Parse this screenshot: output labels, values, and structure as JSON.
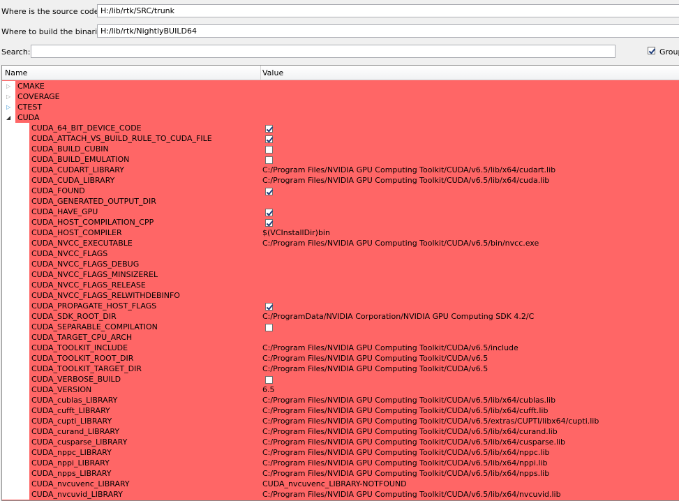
{
  "source": {
    "label": "Where is the source code:",
    "value": "H:/lib/rtk/SRC/trunk"
  },
  "build": {
    "label": "Where to build the binaries:",
    "value": "H:/lib/rtk/NightlyBUILD64"
  },
  "search": {
    "label": "Search:",
    "value": ""
  },
  "grouped": {
    "label": "Group",
    "checked": true
  },
  "columns": {
    "name": "Name",
    "value": "Value"
  },
  "colors": {
    "highlight": "#ff6666",
    "window": "#f0f0f0"
  },
  "groups": [
    {
      "name": "CMAKE",
      "expanded": false,
      "arrow": "gray"
    },
    {
      "name": "COVERAGE",
      "expanded": false,
      "arrow": "gray"
    },
    {
      "name": "CTEST",
      "expanded": false,
      "arrow": "blue"
    },
    {
      "name": "CUDA",
      "expanded": true,
      "arrow": "dark"
    }
  ],
  "entries": [
    {
      "name": "CUDA_64_BIT_DEVICE_CODE",
      "type": "bool",
      "checked": true
    },
    {
      "name": "CUDA_ATTACH_VS_BUILD_RULE_TO_CUDA_FILE",
      "type": "bool",
      "checked": true
    },
    {
      "name": "CUDA_BUILD_CUBIN",
      "type": "bool",
      "checked": false
    },
    {
      "name": "CUDA_BUILD_EMULATION",
      "type": "bool",
      "checked": false
    },
    {
      "name": "CUDA_CUDART_LIBRARY",
      "type": "text",
      "value": "C:/Program Files/NVIDIA GPU Computing Toolkit/CUDA/v6.5/lib/x64/cudart.lib"
    },
    {
      "name": "CUDA_CUDA_LIBRARY",
      "type": "text",
      "value": "C:/Program Files/NVIDIA GPU Computing Toolkit/CUDA/v6.5/lib/x64/cuda.lib"
    },
    {
      "name": "CUDA_FOUND",
      "type": "bool",
      "checked": true
    },
    {
      "name": "CUDA_GENERATED_OUTPUT_DIR",
      "type": "text",
      "value": ""
    },
    {
      "name": "CUDA_HAVE_GPU",
      "type": "bool",
      "checked": true
    },
    {
      "name": "CUDA_HOST_COMPILATION_CPP",
      "type": "bool",
      "checked": true
    },
    {
      "name": "CUDA_HOST_COMPILER",
      "type": "text",
      "value": "$(VCInstallDir)bin"
    },
    {
      "name": "CUDA_NVCC_EXECUTABLE",
      "type": "text",
      "value": "C:/Program Files/NVIDIA GPU Computing Toolkit/CUDA/v6.5/bin/nvcc.exe"
    },
    {
      "name": "CUDA_NVCC_FLAGS",
      "type": "text",
      "value": ""
    },
    {
      "name": "CUDA_NVCC_FLAGS_DEBUG",
      "type": "text",
      "value": ""
    },
    {
      "name": "CUDA_NVCC_FLAGS_MINSIZEREL",
      "type": "text",
      "value": ""
    },
    {
      "name": "CUDA_NVCC_FLAGS_RELEASE",
      "type": "text",
      "value": ""
    },
    {
      "name": "CUDA_NVCC_FLAGS_RELWITHDEBINFO",
      "type": "text",
      "value": ""
    },
    {
      "name": "CUDA_PROPAGATE_HOST_FLAGS",
      "type": "bool",
      "checked": true
    },
    {
      "name": "CUDA_SDK_ROOT_DIR",
      "type": "text",
      "value": "C:/ProgramData/NVIDIA Corporation/NVIDIA GPU Computing SDK 4.2/C"
    },
    {
      "name": "CUDA_SEPARABLE_COMPILATION",
      "type": "bool",
      "checked": false
    },
    {
      "name": "CUDA_TARGET_CPU_ARCH",
      "type": "text",
      "value": ""
    },
    {
      "name": "CUDA_TOOLKIT_INCLUDE",
      "type": "text",
      "value": "C:/Program Files/NVIDIA GPU Computing Toolkit/CUDA/v6.5/include"
    },
    {
      "name": "CUDA_TOOLKIT_ROOT_DIR",
      "type": "text",
      "value": "C:/Program Files/NVIDIA GPU Computing Toolkit/CUDA/v6.5"
    },
    {
      "name": "CUDA_TOOLKIT_TARGET_DIR",
      "type": "text",
      "value": "C:/Program Files/NVIDIA GPU Computing Toolkit/CUDA/v6.5"
    },
    {
      "name": "CUDA_VERBOSE_BUILD",
      "type": "bool",
      "checked": false
    },
    {
      "name": "CUDA_VERSION",
      "type": "text",
      "value": "6.5"
    },
    {
      "name": "CUDA_cublas_LIBRARY",
      "type": "text",
      "value": "C:/Program Files/NVIDIA GPU Computing Toolkit/CUDA/v6.5/lib/x64/cublas.lib"
    },
    {
      "name": "CUDA_cufft_LIBRARY",
      "type": "text",
      "value": "C:/Program Files/NVIDIA GPU Computing Toolkit/CUDA/v6.5/lib/x64/cufft.lib"
    },
    {
      "name": "CUDA_cupti_LIBRARY",
      "type": "text",
      "value": "C:/Program Files/NVIDIA GPU Computing Toolkit/CUDA/v6.5/extras/CUPTI/libx64/cupti.lib"
    },
    {
      "name": "CUDA_curand_LIBRARY",
      "type": "text",
      "value": "C:/Program Files/NVIDIA GPU Computing Toolkit/CUDA/v6.5/lib/x64/curand.lib"
    },
    {
      "name": "CUDA_cusparse_LIBRARY",
      "type": "text",
      "value": "C:/Program Files/NVIDIA GPU Computing Toolkit/CUDA/v6.5/lib/x64/cusparse.lib"
    },
    {
      "name": "CUDA_nppc_LIBRARY",
      "type": "text",
      "value": "C:/Program Files/NVIDIA GPU Computing Toolkit/CUDA/v6.5/lib/x64/nppc.lib"
    },
    {
      "name": "CUDA_nppi_LIBRARY",
      "type": "text",
      "value": "C:/Program Files/NVIDIA GPU Computing Toolkit/CUDA/v6.5/lib/x64/nppi.lib"
    },
    {
      "name": "CUDA_npps_LIBRARY",
      "type": "text",
      "value": "C:/Program Files/NVIDIA GPU Computing Toolkit/CUDA/v6.5/lib/x64/npps.lib"
    },
    {
      "name": "CUDA_nvcuvenc_LIBRARY",
      "type": "text",
      "value": "CUDA_nvcuvenc_LIBRARY-NOTFOUND"
    },
    {
      "name": "CUDA_nvcuvid_LIBRARY",
      "type": "text",
      "value": "C:/Program Files/NVIDIA GPU Computing Toolkit/CUDA/v6.5/lib/x64/nvcuvid.lib"
    }
  ]
}
